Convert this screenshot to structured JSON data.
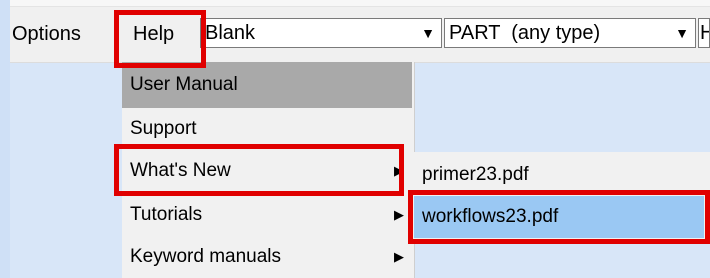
{
  "menubar": {
    "options_label": "Options",
    "help_label": "Help",
    "dropdown1_value": "Blank",
    "dropdown2_value": "PART  (any type)",
    "dropdown3_value": "H",
    "dropdown_arrow": "▼"
  },
  "help_menu": {
    "items": [
      {
        "label": "User Manual"
      },
      {
        "label": "Support"
      },
      {
        "label": "What's New"
      },
      {
        "label": "Tutorials"
      },
      {
        "label": "Keyword manuals"
      }
    ],
    "submenu_arrow": "▶"
  },
  "whats_new_submenu": {
    "items": [
      {
        "label": "primer23.pdf"
      },
      {
        "label": "workflows23.pdf"
      }
    ]
  },
  "colors": {
    "highlight_border": "#e00000",
    "hover_bg": "#a9a9a9",
    "selected_bg": "#9ac8f3"
  }
}
